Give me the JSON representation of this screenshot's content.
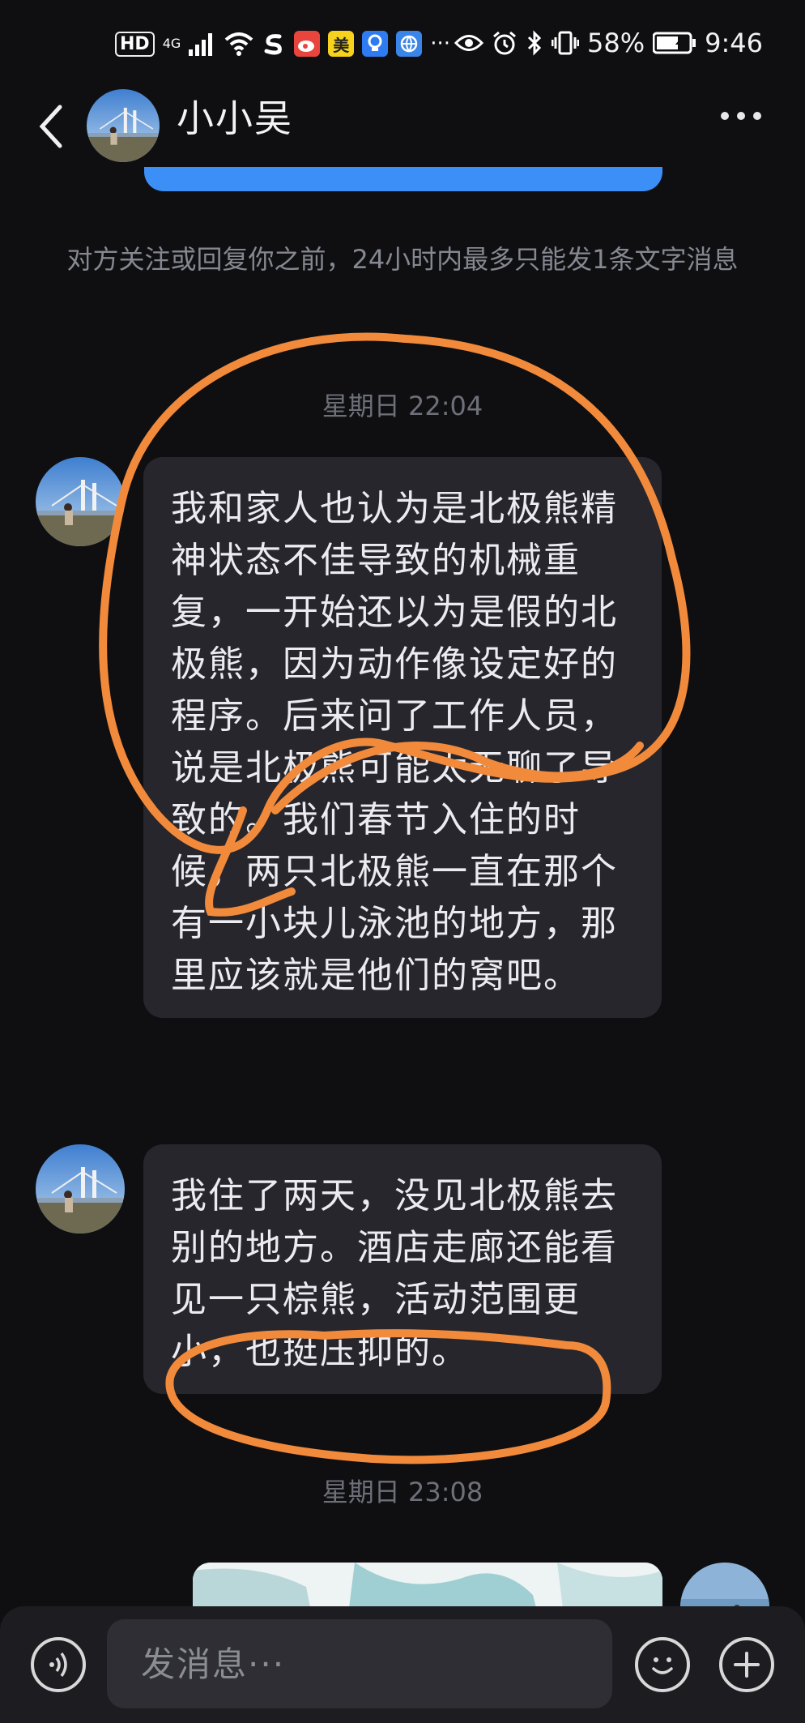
{
  "status_bar": {
    "hd_label": "HD",
    "network_label": "4G",
    "app_badge_1": "美",
    "overflow": "···",
    "battery": "58%",
    "time": "9:46"
  },
  "header": {
    "title": "小小吴"
  },
  "notice": "对方关注或回复你之前，24小时内最多只能发1条文字消息",
  "timestamps": [
    "星期日 22:04",
    "星期日 23:08"
  ],
  "messages": [
    {
      "text": "我和家人也认为是北极熊精神状态不佳导致的机械重复，一开始还以为是假的北极熊，因为动作像设定好的程序。后来问了工作人员，说是北极熊可能太无聊了导致的。我们春节入住的时候，两只北极熊一直在那个有一小块儿泳池的地方，那里应该就是他们的窝吧。"
    },
    {
      "text": "我住了两天，没见北极熊去别的地方。酒店走廊还能看见一只棕熊，活动范围更小，也挺压抑的。"
    }
  ],
  "input": {
    "placeholder": "发消息···"
  },
  "colors": {
    "background": "#0f0f12",
    "bubble": "#26262c",
    "accent_blue": "#3b8ff7",
    "annotation_orange": "#f28a3c"
  }
}
